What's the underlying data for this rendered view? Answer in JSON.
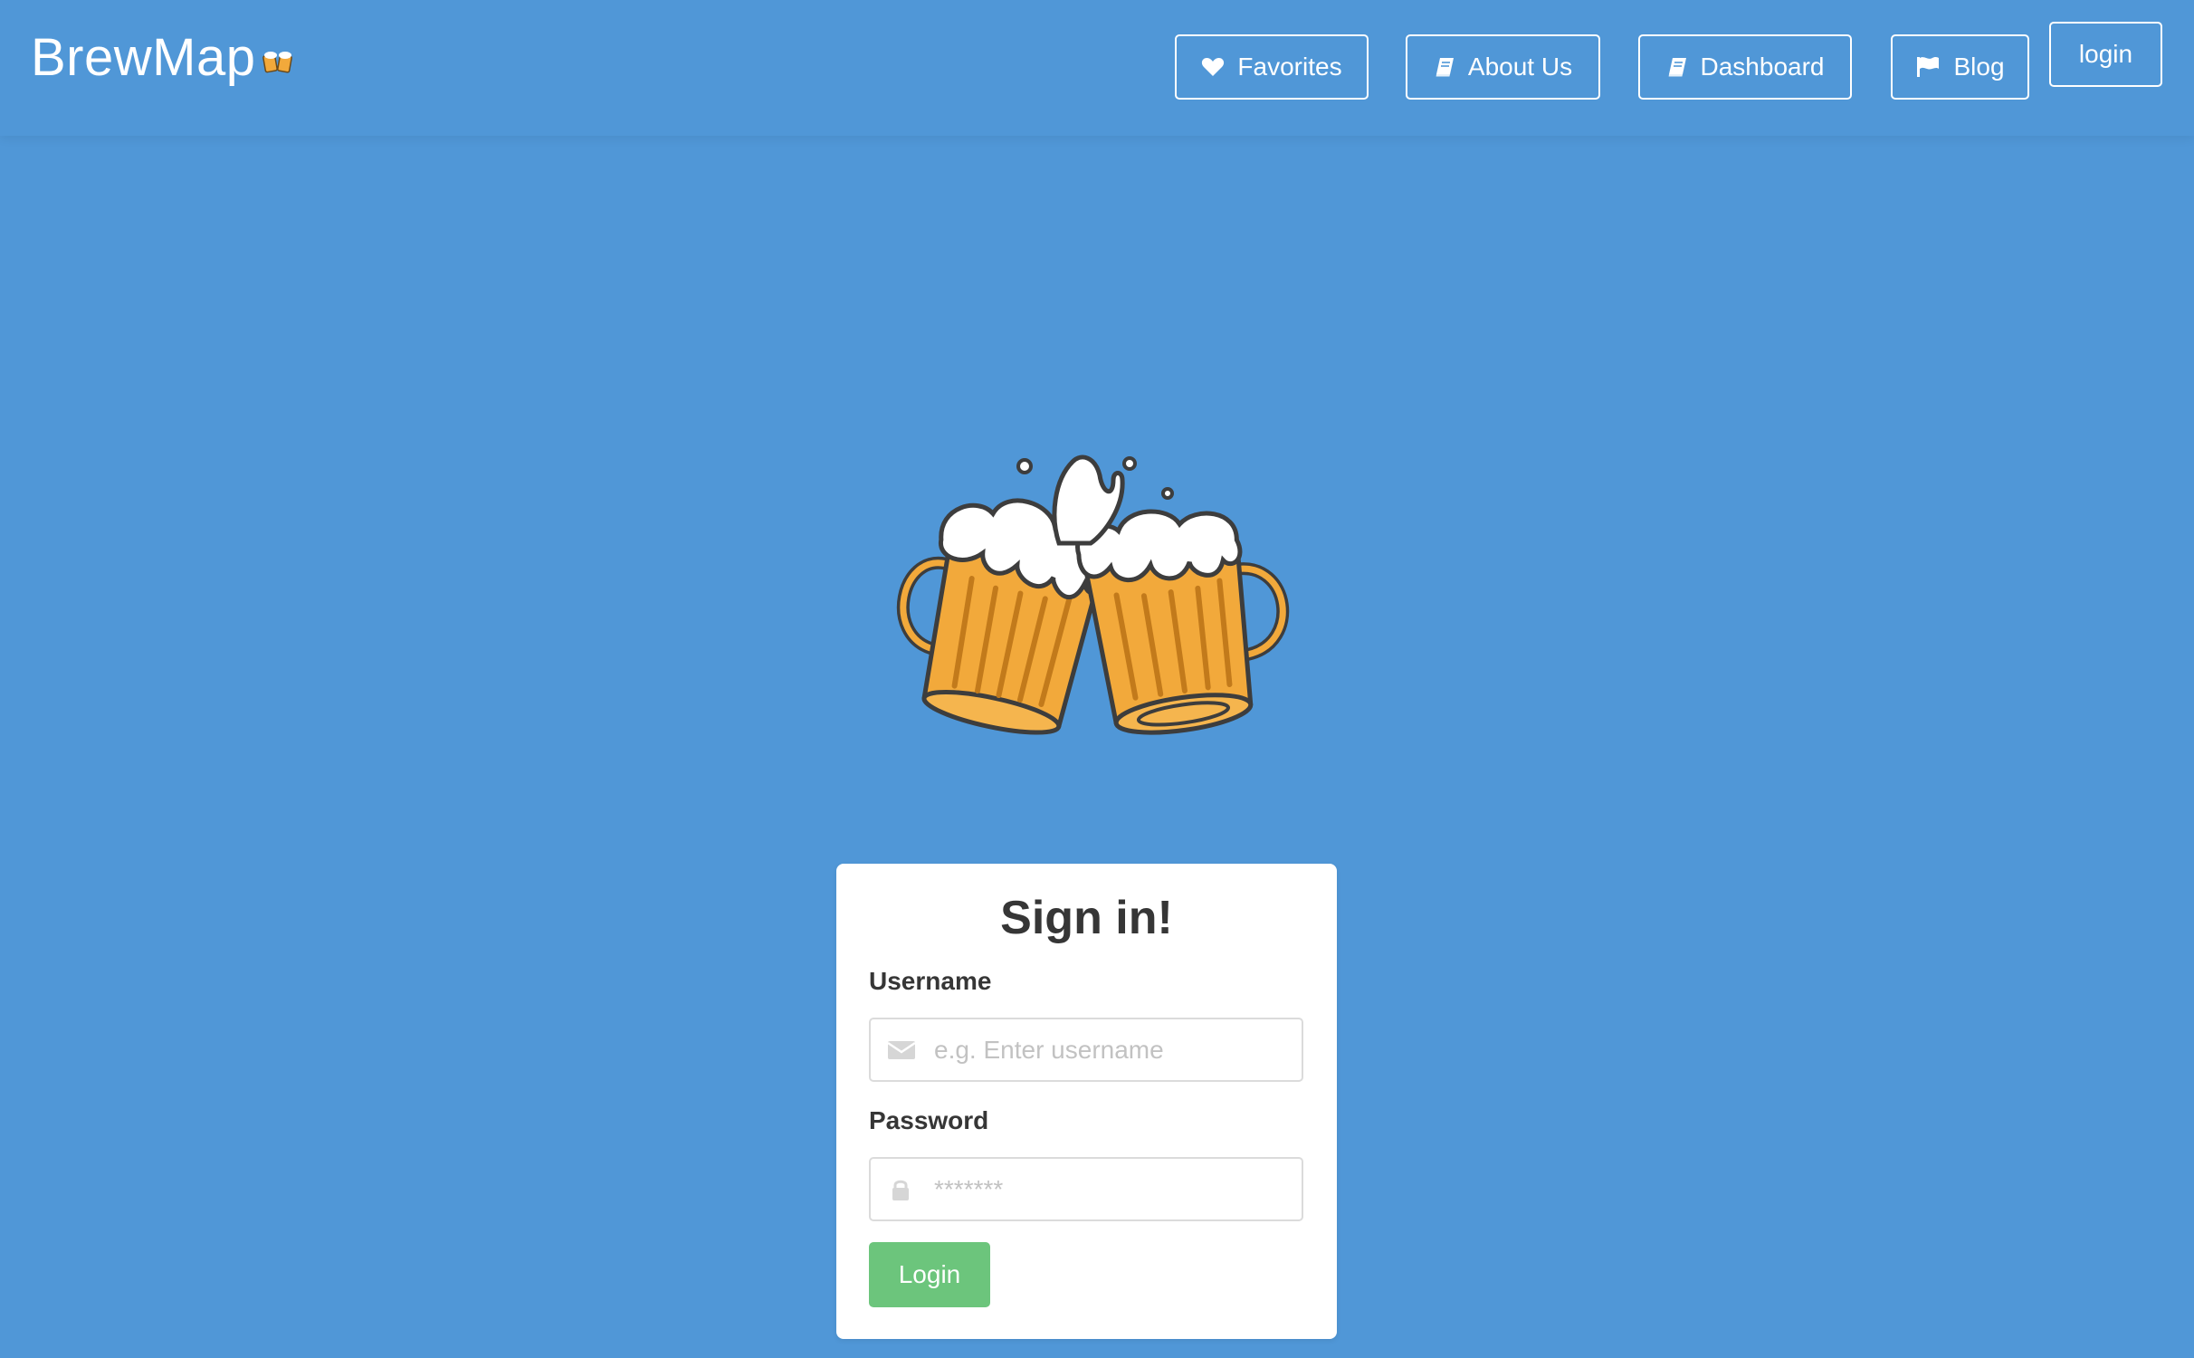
{
  "brand": {
    "name": "BrewMap",
    "emoji": "🍻"
  },
  "nav": {
    "favorites": "Favorites",
    "about": "About Us",
    "dashboard": "Dashboard",
    "blog": "Blog",
    "login": "login",
    "icons": {
      "favorites": "heart-icon",
      "about": "book-icon",
      "dashboard": "book-icon",
      "blog": "flag-icon"
    }
  },
  "hero": {
    "image": "clinking-beer-mugs-illustration"
  },
  "form": {
    "title": "Sign in!",
    "username_label": "Username",
    "username_placeholder": "e.g. Enter username",
    "username_icon": "envelope-icon",
    "password_label": "Password",
    "password_placeholder": "*******",
    "password_icon": "lock-icon",
    "submit_label": "Login"
  },
  "colors": {
    "background": "#5097d7",
    "submit": "#6cc57c",
    "beer": "#f2a93b",
    "outline": "#3d3d3d"
  }
}
